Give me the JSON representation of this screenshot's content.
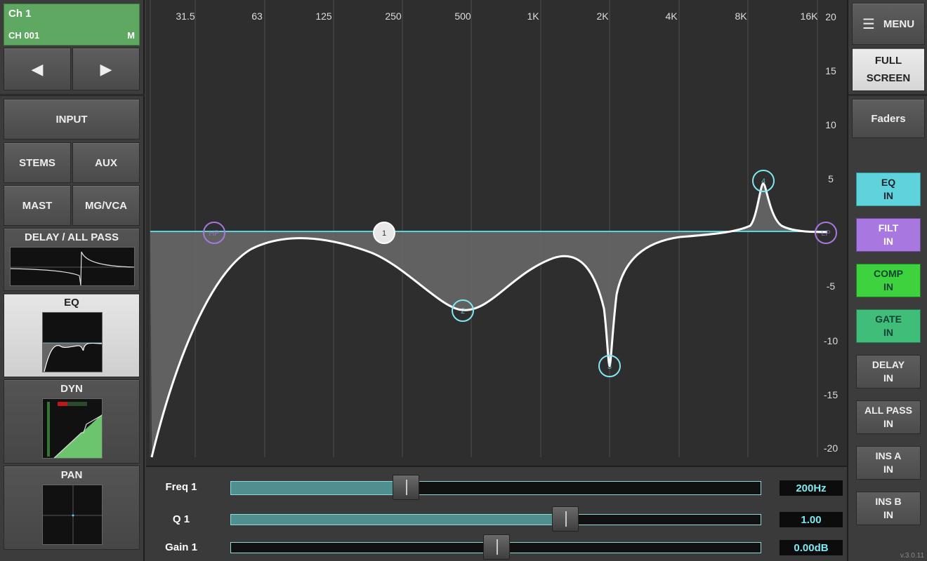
{
  "channel": {
    "name": "Ch 1",
    "id": "CH 001",
    "mode": "M"
  },
  "nav": {
    "prev": "◀",
    "next": "▶"
  },
  "left_menu": {
    "input": "INPUT",
    "stems": "STEMS",
    "aux": "AUX",
    "mast": "MAST",
    "mgvca": "MG/VCA",
    "delay": "DELAY / ALL PASS",
    "eq": "EQ",
    "dyn": "DYN",
    "pan": "PAN"
  },
  "graph": {
    "freq_labels": [
      "31.5",
      "63",
      "125",
      "250",
      "500",
      "1K",
      "2K",
      "4K",
      "8K",
      "16K"
    ],
    "db_labels": [
      "20",
      "15",
      "10",
      "5",
      "-5",
      "-10",
      "-15",
      "-20"
    ],
    "nodes": [
      {
        "label": "HP",
        "color": "#a877e0"
      },
      {
        "label": "1",
        "color": "#ffffff"
      },
      {
        "label": "2",
        "color": "#7fe8f0"
      },
      {
        "label": "3",
        "color": "#7fe8f0"
      },
      {
        "label": "4",
        "color": "#7fe8f0"
      },
      {
        "label": "LP",
        "color": "#a877e0"
      }
    ],
    "colors": {
      "zero_line": "#5fd3dc",
      "curve": "#ffffff",
      "fill": "#6a6a6a"
    }
  },
  "params": [
    {
      "label": "Freq 1",
      "value": "200Hz",
      "fraction": 0.33
    },
    {
      "label": "Q 1",
      "value": "1.00",
      "fraction": 0.63
    },
    {
      "label": "Gain 1",
      "value": "0.00dB",
      "fraction": 0.5
    }
  ],
  "right_menu": {
    "menu": "MENU",
    "full_screen_1": "FULL",
    "full_screen_2": "SCREEN",
    "faders": "Faders"
  },
  "indicators": [
    {
      "l1": "EQ",
      "l2": "IN"
    },
    {
      "l1": "FILT",
      "l2": "IN"
    },
    {
      "l1": "COMP",
      "l2": "IN"
    },
    {
      "l1": "GATE",
      "l2": "IN"
    },
    {
      "l1": "DELAY",
      "l2": "IN"
    },
    {
      "l1": "ALL PASS",
      "l2": "IN"
    },
    {
      "l1": "INS A",
      "l2": "IN"
    },
    {
      "l1": "INS B",
      "l2": "IN"
    }
  ],
  "version": "v.3.0.11"
}
